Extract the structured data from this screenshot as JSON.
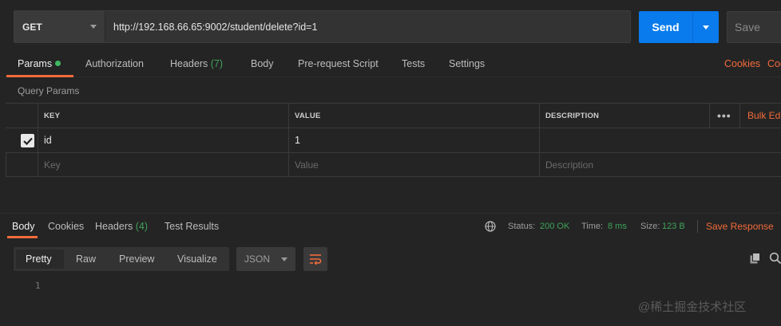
{
  "request": {
    "method": "GET",
    "url": "http://192.168.66.65:9002/student/delete?id=1",
    "send_label": "Send",
    "save_label": "Save"
  },
  "request_tabs": {
    "params": "Params",
    "authorization": "Authorization",
    "headers": "Headers",
    "headers_count": "(7)",
    "body": "Body",
    "prerequest": "Pre-request Script",
    "tests": "Tests",
    "settings": "Settings",
    "cookies": "Cookies",
    "code": "Code"
  },
  "query_params": {
    "title": "Query Params",
    "columns": {
      "key": "KEY",
      "value": "VALUE",
      "description": "DESCRIPTION"
    },
    "bulk_edit": "Bulk Edit",
    "more": "•••",
    "rows": [
      {
        "key": "id",
        "value": "1",
        "description": "",
        "checked": true
      }
    ],
    "placeholders": {
      "key": "Key",
      "value": "Value",
      "description": "Description"
    }
  },
  "response_tabs": {
    "body": "Body",
    "cookies": "Cookies",
    "headers": "Headers",
    "headers_count": "(4)",
    "test_results": "Test Results"
  },
  "response_meta": {
    "status_label": "Status:",
    "status_value": "200 OK",
    "time_label": "Time:",
    "time_value": "8 ms",
    "size_label": "Size:",
    "size_value": "123 B",
    "save_response": "Save Response"
  },
  "format_bar": {
    "pretty": "Pretty",
    "raw": "Raw",
    "preview": "Preview",
    "visualize": "Visualize",
    "format": "JSON"
  },
  "editor": {
    "line_number": "1"
  },
  "watermark": "@稀土掘金技术社区",
  "icons": [
    "chevron-down-icon",
    "status-dot-icon",
    "checkbox-checked-icon",
    "more-icon",
    "globe-icon",
    "wrap-icon",
    "copy-icon",
    "search-icon"
  ],
  "colors": {
    "accent": "#f26b3a",
    "send": "#097bed",
    "success": "#3fa35a",
    "background": "#242424"
  }
}
